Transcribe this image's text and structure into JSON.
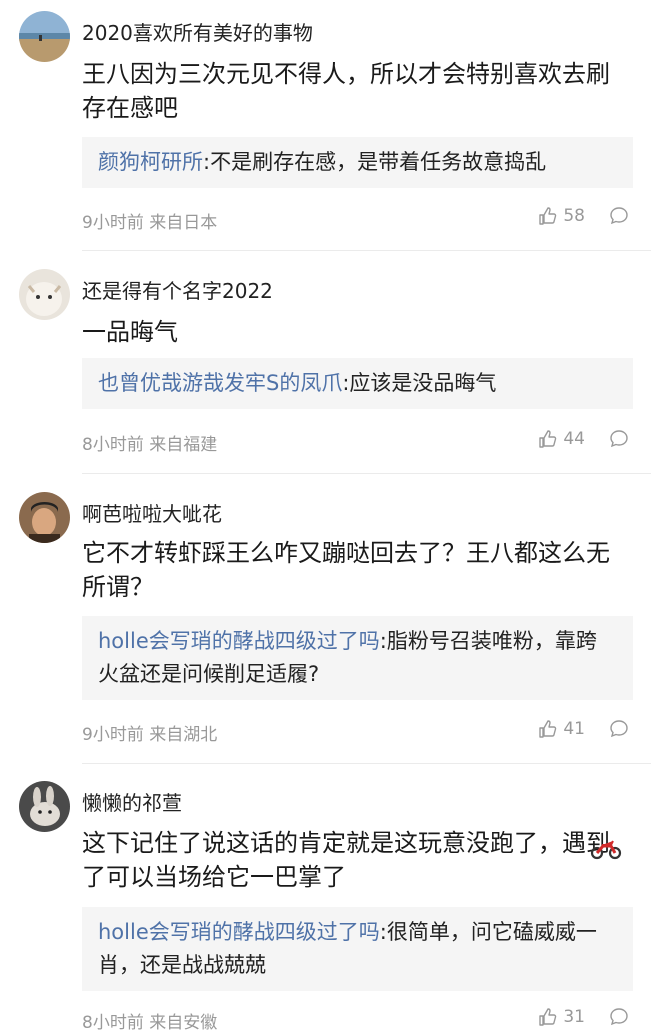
{
  "comments": [
    {
      "username": "2020喜欢所有美好的事物",
      "content": "王八因为三次元见不得人，所以才会特别喜欢去刷存在感吧",
      "reply_user": "颜狗柯研所",
      "reply_text": ":不是刷存在感，是带着任务故意捣乱",
      "time": "9小时前",
      "location": "来自日本",
      "likes": "58"
    },
    {
      "username": "还是得有个名字2022",
      "content": "一品晦气",
      "reply_user": "也曾优哉游哉发牢S的凤爪",
      "reply_text": ":应该是没品晦气",
      "time": "8小时前",
      "location": "来自福建",
      "likes": "44"
    },
    {
      "username": "啊芭啦啦大呲花",
      "content": "它不才转虾踩王么咋又蹦哒回去了？王八都这么无所谓？",
      "reply_user": "holle会写琑的酵战四级过了吗",
      "reply_text": ":脂粉号召装唯粉，靠跨火盆还是问候削足适履?",
      "time": "9小时前",
      "location": "来自湖北",
      "likes": "41"
    },
    {
      "username": "懒懒的祁萱",
      "content": "这下记住了说这话的肯定就是这玩意没跑了，遇到了可以当场给它一巴掌了",
      "reply_user": "holle会写琑的酵战四级过了吗",
      "reply_text": ":很简单，问它磕威威一肖，还是战战兢兢",
      "time": "8小时前",
      "location": "来自安徽",
      "likes": "31"
    }
  ],
  "colors": {
    "reply_user": "#4f72a8",
    "meta": "#999999",
    "reply_bg": "#f5f5f5"
  },
  "icons": {
    "like": "thumbs-up-icon",
    "comment": "comment-bubble-icon",
    "emoji": "motorcycle-emoji"
  }
}
